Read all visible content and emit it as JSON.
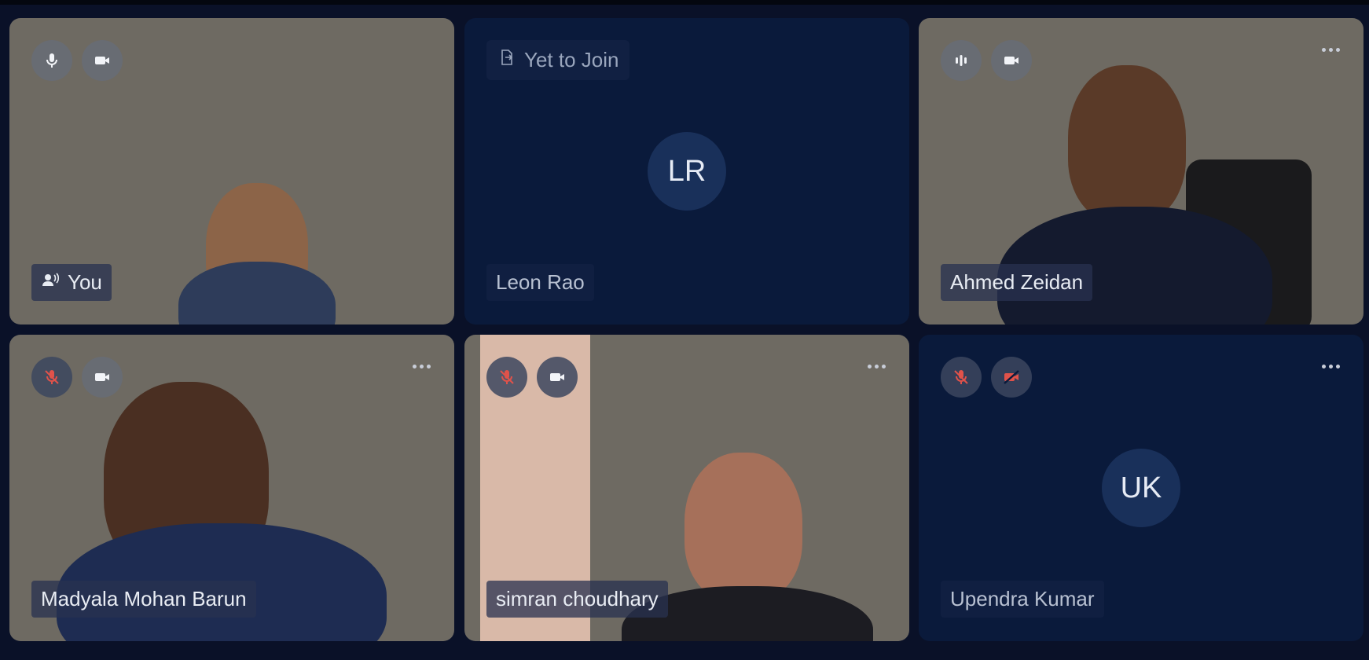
{
  "participants": [
    {
      "name": "You",
      "initials": ""
    },
    {
      "name": "Leon Rao",
      "initials": "LR",
      "status": "Yet to Join"
    },
    {
      "name": "Ahmed Zeidan",
      "initials": ""
    },
    {
      "name": "Madyala Mohan Barun",
      "initials": ""
    },
    {
      "name": "simran choudhary",
      "initials": ""
    },
    {
      "name": "Upendra Kumar",
      "initials": "UK"
    }
  ],
  "icons": {
    "mic": "microphone-icon",
    "mic_muted": "microphone-muted-icon",
    "camera": "camera-icon",
    "camera_off": "camera-off-icon",
    "speaking": "audio-level-icon",
    "more": "more-options-icon",
    "join": "exit-door-icon",
    "speaker": "speaker-icon"
  },
  "colors": {
    "background": "#0a1128",
    "tile": "#0a1a3b",
    "muted_red": "#e0524a",
    "icon_white": "#f2f4f8"
  }
}
